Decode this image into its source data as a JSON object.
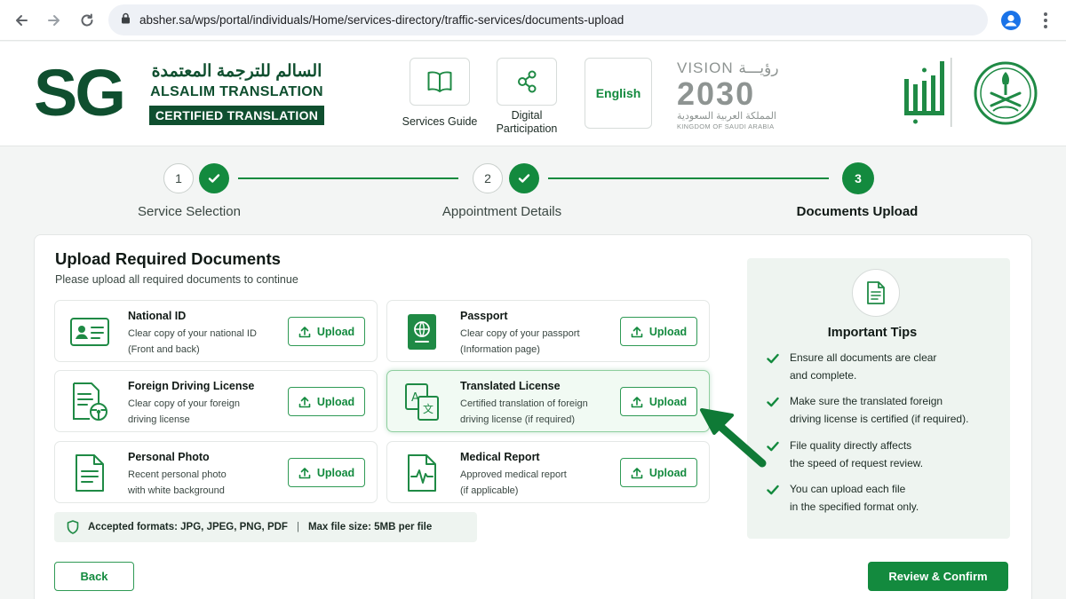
{
  "browser": {
    "url": "absher.sa/wps/portal/individuals/Home/services-directory/traffic-services/documents-upload",
    "icons": [
      "back-arrow-icon",
      "forward-arrow-icon",
      "reload-icon",
      "lock-icon",
      "profile-icon",
      "more-menu-icon"
    ]
  },
  "header": {
    "logo_text": "SG",
    "brand_arabic": "السالم للترجمة المعتمدة",
    "brand_english": "ALSALIM TRANSLATION",
    "brand_certified": "CERTIFIED TRANSLATION",
    "services_guide": "Services Guide",
    "digital_participation": "Digital Participation",
    "language": "English",
    "vision": {
      "top": "VISION رؤيـــة",
      "year": "2030",
      "arabic": "المملكة العربية السعودية",
      "english": "KINGDOM OF SAUDI ARABIA"
    }
  },
  "stepper": {
    "steps": [
      {
        "number": "1",
        "label": "Service Selection",
        "status": "completed"
      },
      {
        "number": "2",
        "label": "Appointment Details",
        "status": "completed"
      },
      {
        "number": "3",
        "label": "Documents Upload",
        "status": "active"
      }
    ]
  },
  "main": {
    "title": "Upload Required Documents",
    "subtitle": "Please upload all required documents to continue",
    "upload_label": "Upload",
    "documents": [
      {
        "title": "National ID",
        "desc1": "Clear copy of your national ID",
        "desc2": "(Front and back)",
        "icon": "id-card-icon"
      },
      {
        "title": "Passport",
        "desc1": "Clear copy of your passport",
        "desc2": "(Information page)",
        "icon": "passport-icon"
      },
      {
        "title": "Foreign Driving License",
        "desc1": "Clear copy of your foreign",
        "desc2": "driving license",
        "icon": "driving-license-icon"
      },
      {
        "title": "Translated License",
        "desc1": "Certified translation of foreign",
        "desc2": "driving license (if required)",
        "icon": "translate-icon",
        "highlighted": true
      },
      {
        "title": "Personal Photo",
        "desc1": "Recent personal photo",
        "desc2": "with white background",
        "icon": "document-icon"
      },
      {
        "title": "Medical Report",
        "desc1": "Approved medical report",
        "desc2": "(if applicable)",
        "icon": "medical-report-icon"
      }
    ],
    "formats": "Accepted formats: JPG, JPEG, PNG, PDF",
    "separator": "|",
    "max_size": "Max file size: 5MB per file",
    "back_label": "Back",
    "confirm_label": "Review & Confirm"
  },
  "tips": {
    "title": "Important Tips",
    "items": [
      {
        "line1": "Ensure all documents are clear",
        "line2": "and complete."
      },
      {
        "line1": "Make sure the translated foreign",
        "line2": "driving license is certified (if required)."
      },
      {
        "line1": "File quality directly affects",
        "line2": "the speed of request review."
      },
      {
        "line1": "You can upload each file",
        "line2": "in the specified format only."
      }
    ]
  },
  "colors": {
    "primary_green": "#138a3e",
    "dark_green": "#0f4f2f",
    "tips_background": "#eef4f0",
    "highlight_border": "#8fcf9f"
  }
}
